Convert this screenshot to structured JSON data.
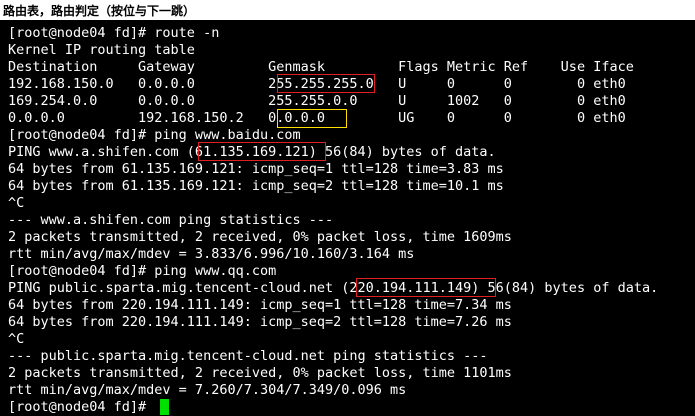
{
  "header": {
    "title": "路由表，路由判定（按位与下一跳）"
  },
  "terminal": {
    "lines": [
      "[root@node04 fd]# route -n",
      "Kernel IP routing table",
      "Destination     Gateway         Genmask         Flags Metric Ref    Use Iface",
      "192.168.150.0   0.0.0.0         255.255.255.0   U     0      0        0 eth0",
      "169.254.0.0     0.0.0.0         255.255.0.0     U     1002   0        0 eth0",
      "0.0.0.0         192.168.150.2   0.0.0.0         UG    0      0        0 eth0",
      "[root@node04 fd]# ping www.baidu.com",
      "PING www.a.shifen.com (61.135.169.121) 56(84) bytes of data.",
      "64 bytes from 61.135.169.121: icmp_seq=1 ttl=128 time=3.83 ms",
      "64 bytes from 61.135.169.121: icmp_seq=2 ttl=128 time=10.1 ms",
      "^C",
      "--- www.a.shifen.com ping statistics ---",
      "2 packets transmitted, 2 received, 0% packet loss, time 1609ms",
      "rtt min/avg/max/mdev = 3.833/6.996/10.160/3.164 ms",
      "[root@node04 fd]# ping www.qq.com",
      "PING public.sparta.mig.tencent-cloud.net (220.194.111.149) 56(84) bytes of data.",
      "64 bytes from 220.194.111.149: icmp_seq=1 ttl=128 time=7.34 ms",
      "64 bytes from 220.194.111.149: icmp_seq=2 ttl=128 time=7.26 ms",
      "^C",
      "--- public.sparta.mig.tencent-cloud.net ping statistics ---",
      "2 packets transmitted, 2 received, 0% packet loss, time 1101ms",
      "rtt min/avg/max/mdev = 7.260/7.304/7.349/0.096 ms",
      "[root@node04 fd]# "
    ]
  },
  "colors": {
    "background": "#000000",
    "text": "#ffffff",
    "highlight_red": "#e02020",
    "highlight_yellow": "#ffe000",
    "cursor": "#00e000"
  }
}
